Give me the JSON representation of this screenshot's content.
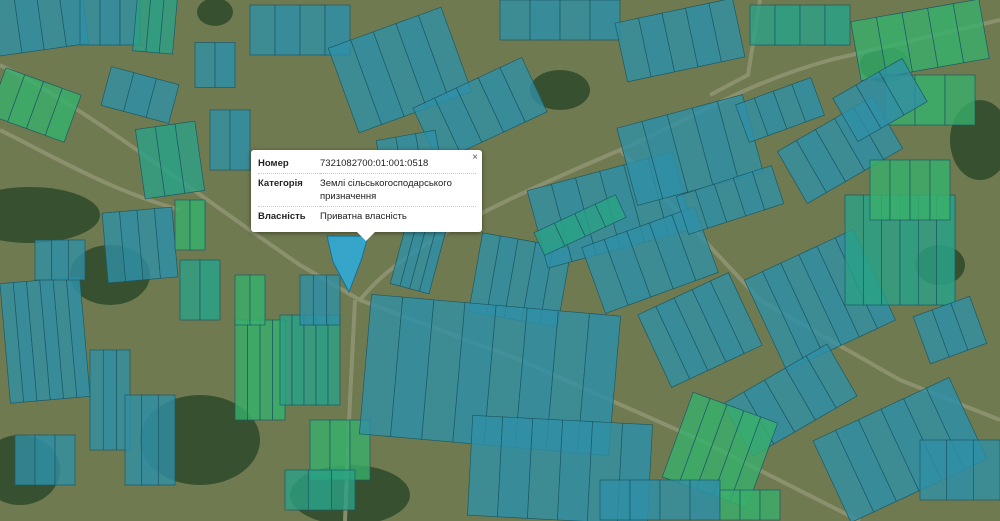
{
  "map": {
    "colors": {
      "background": "#6f7a50",
      "parcel_blue": "#2f8fa7",
      "parcel_teal": "#2aa286",
      "parcel_green": "#38b06b",
      "parcel_bright": "#30a8d4",
      "parcel_border": "#1c5a66",
      "road": "#8e9471",
      "forest": "#2e4a2a"
    }
  },
  "popup": {
    "close_label": "×",
    "rows": [
      {
        "label": "Номер",
        "value": "7321082700:01:001:0518"
      },
      {
        "label": "Категорія",
        "value": "Землі сільськогосподарського призначення"
      },
      {
        "label": "Власність",
        "value": "Приватна власність"
      }
    ]
  }
}
